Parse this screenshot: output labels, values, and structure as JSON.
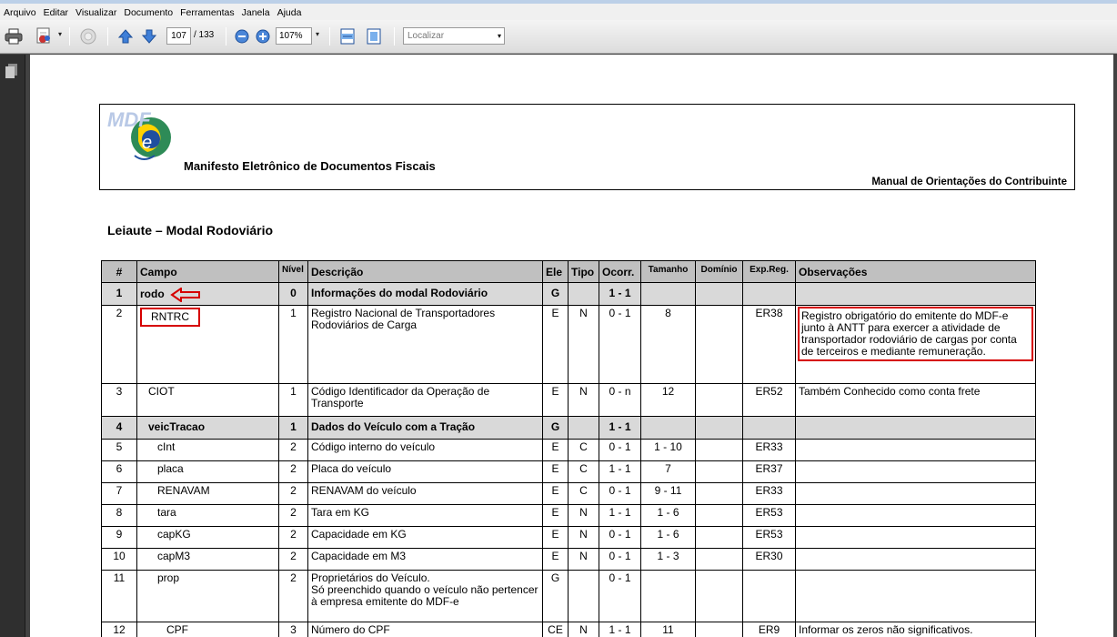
{
  "menu": [
    "Arquivo",
    "Editar",
    "Visualizar",
    "Documento",
    "Ferramentas",
    "Janela",
    "Ajuda"
  ],
  "toolbar": {
    "current_page": "107",
    "total_pages": "/ 133",
    "zoom": "107%",
    "search_placeholder": "Localizar"
  },
  "document": {
    "header_title": "Manifesto Eletrônico de Documentos Fiscais",
    "header_right": "Manual de Orientações do Contribuinte",
    "logo_text": "MDF e",
    "section_title": "Leiaute – Modal Rodoviário",
    "table": {
      "headers": [
        "#",
        "Campo",
        "Nível",
        "Descrição",
        "Ele",
        "Tipo",
        "Ocorr.",
        "Tamanho",
        "Domínio",
        "Exp.Reg.",
        "Observações"
      ],
      "rows": [
        {
          "n": "1",
          "campo": "rodo",
          "nivel": "0",
          "desc": "Informações do modal Rodoviário",
          "ele": "G",
          "tipo": "",
          "ocorr": "1 - 1",
          "tam": "",
          "dom": "",
          "exp": "",
          "obs": "",
          "group": true
        },
        {
          "n": "2",
          "campo": "RNTRC",
          "nivel": "1",
          "desc": "Registro Nacional de Transportadores Rodoviários de Carga",
          "ele": "E",
          "tipo": "N",
          "ocorr": "0 - 1",
          "tam": "8",
          "dom": "",
          "exp": "ER38",
          "obs": "Registro obrigatório do emitente do MDF-e junto à ANTT para exercer a atividade de transportador rodoviário de cargas por conta de terceiros e mediante remuneração."
        },
        {
          "n": "3",
          "campo": "CIOT",
          "nivel": "1",
          "desc": "Código Identificador da Operação de Transporte",
          "ele": "E",
          "tipo": "N",
          "ocorr": "0 - n",
          "tam": "12",
          "dom": "",
          "exp": "ER52",
          "obs": "Também Conhecido como conta frete"
        },
        {
          "n": "4",
          "campo": "veicTracao",
          "nivel": "1",
          "desc": "Dados do Veículo com a Tração",
          "ele": "G",
          "tipo": "",
          "ocorr": "1 - 1",
          "tam": "",
          "dom": "",
          "exp": "",
          "obs": "",
          "group": true
        },
        {
          "n": "5",
          "campo": "cInt",
          "nivel": "2",
          "desc": "Código interno do veículo",
          "ele": "E",
          "tipo": "C",
          "ocorr": "0 - 1",
          "tam": "1 - 10",
          "dom": "",
          "exp": "ER33",
          "obs": ""
        },
        {
          "n": "6",
          "campo": "placa",
          "nivel": "2",
          "desc": "Placa do veículo",
          "ele": "E",
          "tipo": "C",
          "ocorr": "1 - 1",
          "tam": "7",
          "dom": "",
          "exp": "ER37",
          "obs": ""
        },
        {
          "n": "7",
          "campo": "RENAVAM",
          "nivel": "2",
          "desc": "RENAVAM do veículo",
          "ele": "E",
          "tipo": "C",
          "ocorr": "0 - 1",
          "tam": "9 - 11",
          "dom": "",
          "exp": "ER33",
          "obs": ""
        },
        {
          "n": "8",
          "campo": "tara",
          "nivel": "2",
          "desc": "Tara em KG",
          "ele": "E",
          "tipo": "N",
          "ocorr": "1 - 1",
          "tam": "1 - 6",
          "dom": "",
          "exp": "ER53",
          "obs": ""
        },
        {
          "n": "9",
          "campo": "capKG",
          "nivel": "2",
          "desc": "Capacidade em KG",
          "ele": "E",
          "tipo": "N",
          "ocorr": "0 - 1",
          "tam": "1 - 6",
          "dom": "",
          "exp": "ER53",
          "obs": ""
        },
        {
          "n": "10",
          "campo": "capM3",
          "nivel": "2",
          "desc": "Capacidade em M3",
          "ele": "E",
          "tipo": "N",
          "ocorr": "0 - 1",
          "tam": "1 - 3",
          "dom": "",
          "exp": "ER30",
          "obs": ""
        },
        {
          "n": "11",
          "campo": "prop",
          "nivel": "2",
          "desc": "Proprietários do Veículo.",
          "desc2": "Só preenchido quando o veículo não pertencer à empresa emitente do MDF-e",
          "ele": "G",
          "tipo": "",
          "ocorr": "0 - 1",
          "tam": "",
          "dom": "",
          "exp": "",
          "obs": ""
        },
        {
          "n": "12",
          "campo": "CPF",
          "nivel": "3",
          "desc": "Número do CPF",
          "ele": "CE",
          "tipo": "N",
          "ocorr": "1 - 1",
          "tam": "11",
          "dom": "",
          "exp": "ER9",
          "obs": "Informar os zeros não significativos."
        }
      ]
    }
  }
}
